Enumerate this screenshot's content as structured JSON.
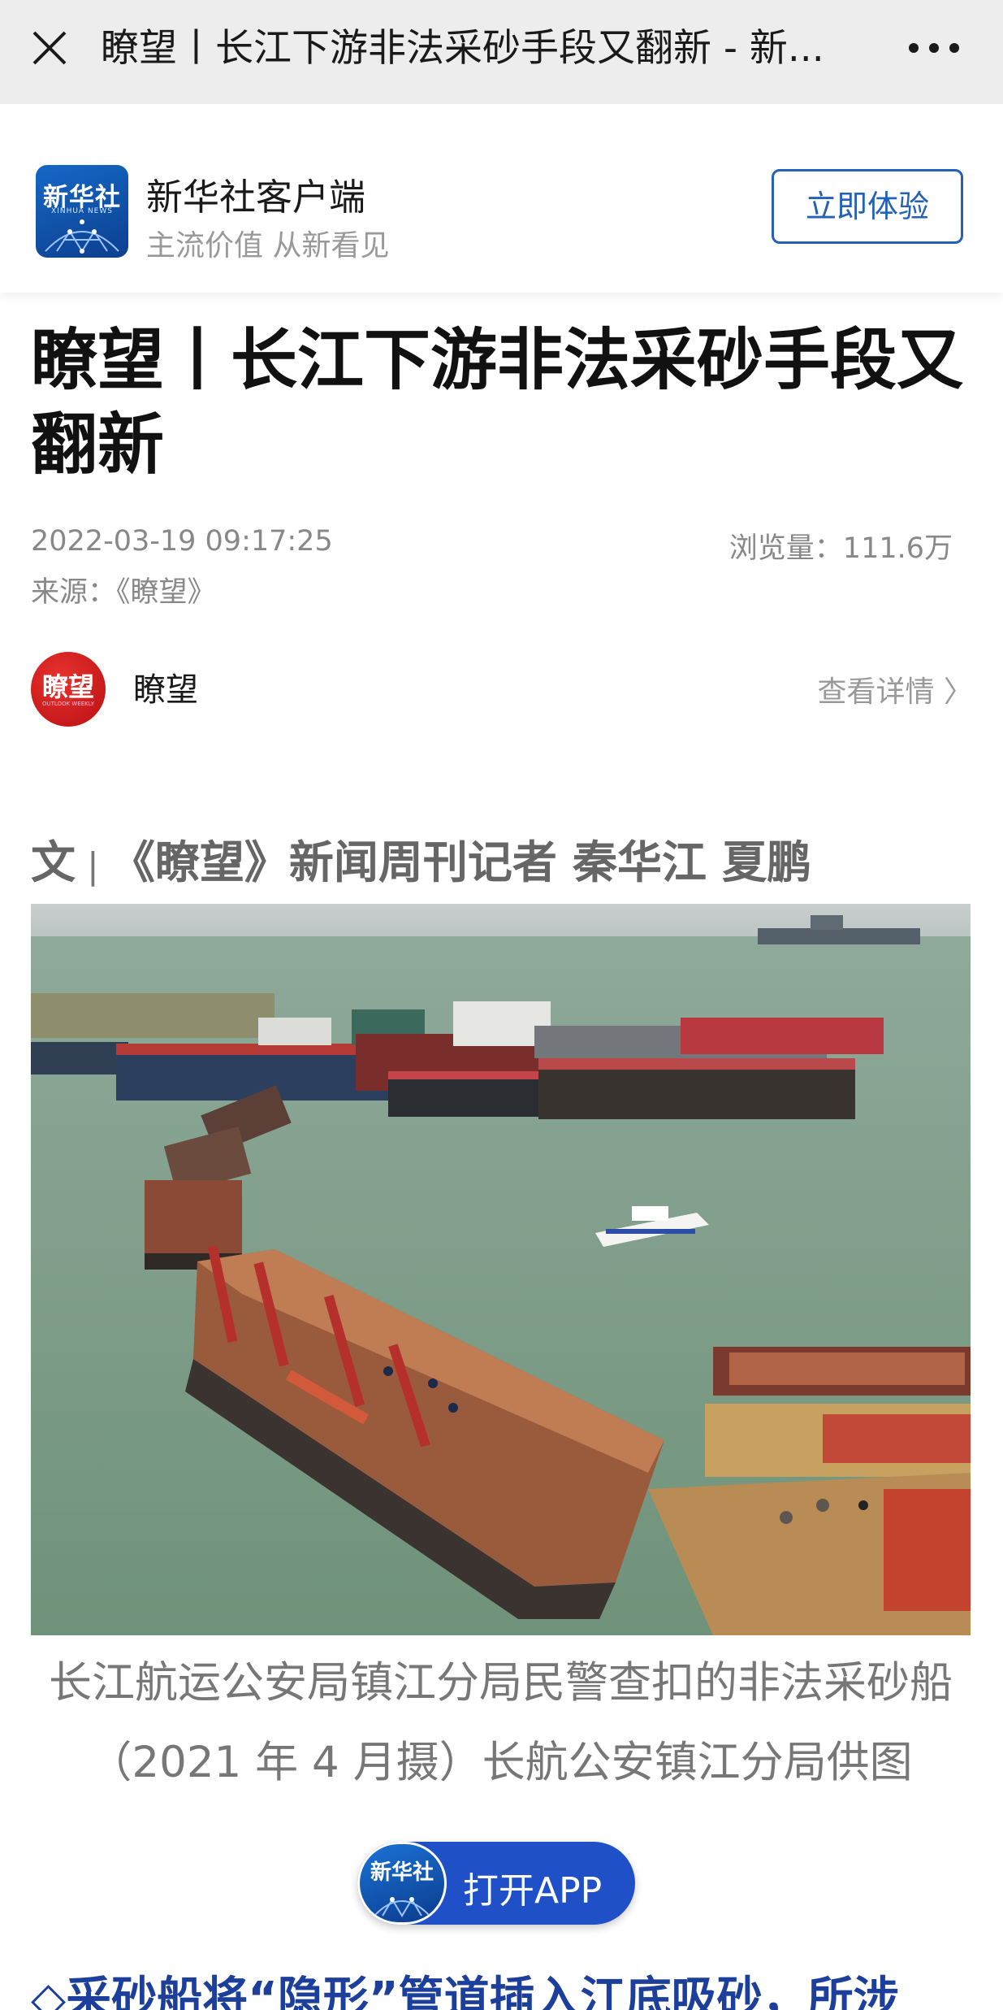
{
  "topbar": {
    "title": "瞭望丨长江下游非法采砂手段又翻新 - 新..."
  },
  "banner": {
    "logo_text": "新华社",
    "logo_sub": "XINHUA NEWS",
    "app_name": "新华社客户端",
    "slogan": "主流价值 从新看见",
    "try_label": "立即体验"
  },
  "article": {
    "title": "瞭望丨长江下游非法采砂手段又翻新",
    "date": "2022-03-19 09:17:25",
    "views": "浏览量：111.6万",
    "source": "来源：《瞭望》"
  },
  "author": {
    "avatar_text": "瞭望",
    "avatar_sub": "OUTLOOK WEEKLY",
    "name": "瞭望",
    "detail_label": "查看详情 〉"
  },
  "byline": {
    "prefix": "文",
    "separator": "|",
    "text": "《瞭望》新闻周刊记者  秦华江  夏鹏"
  },
  "photo": {
    "caption": "长江航运公安局镇江分局民警查扣的非法采砂船（2021 年 4 月摄）长航公安镇江分局供图"
  },
  "open_app": {
    "logo_text": "新华社",
    "label": "打开APP"
  },
  "section_heading": "◇采砂船将“隐形”管道插入江底吸砂，所涉",
  "colors": {
    "topbar_bg": "#ededed",
    "brand_blue": "#2561b8",
    "open_app_blue": "#2050c8",
    "heading_blue": "#1d3f9c"
  }
}
